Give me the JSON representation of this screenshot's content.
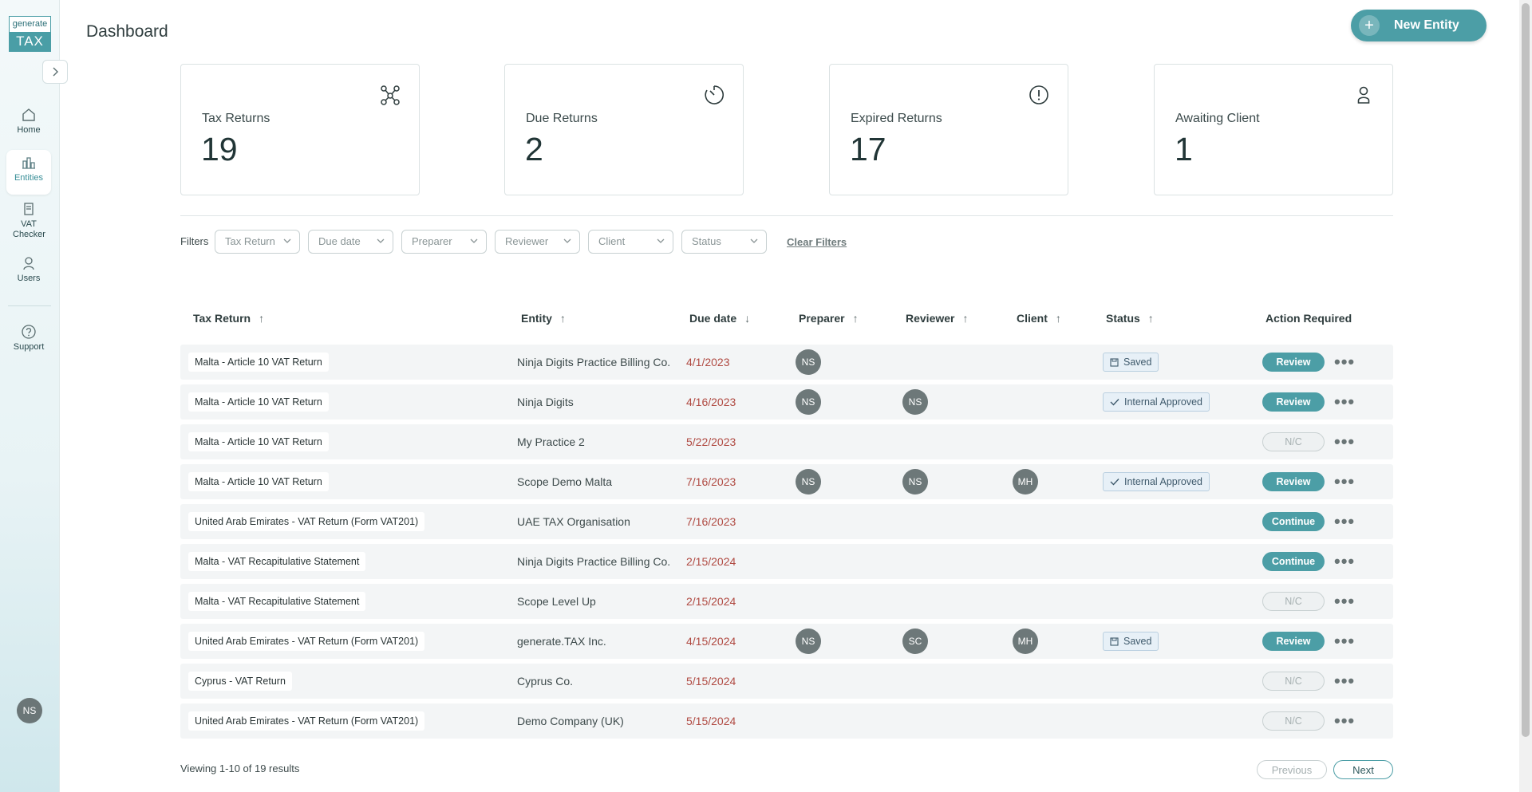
{
  "sidebar": {
    "logo_top": "generate",
    "logo_bottom": "TAX",
    "items": [
      {
        "label": "Home",
        "icon": "home-icon"
      },
      {
        "label": "Entities",
        "icon": "building-icon"
      },
      {
        "label": "VAT Checker",
        "icon": "document-icon"
      },
      {
        "label": "Users",
        "icon": "user-icon"
      },
      {
        "label": "Support",
        "icon": "help-icon"
      }
    ],
    "user_initials": "NS"
  },
  "header": {
    "title": "Dashboard",
    "new_entity_label": "New Entity"
  },
  "cards": [
    {
      "label": "Tax Returns",
      "value": "19",
      "icon": "network-icon"
    },
    {
      "label": "Due Returns",
      "value": "2",
      "icon": "timer-icon"
    },
    {
      "label": "Expired Returns",
      "value": "17",
      "icon": "alert-circle-icon"
    },
    {
      "label": "Awaiting Client",
      "value": "1",
      "icon": "person-icon"
    }
  ],
  "filters": {
    "label": "Filters",
    "items": [
      "Tax Return",
      "Due date",
      "Preparer",
      "Reviewer",
      "Client",
      "Status"
    ],
    "clear_label": "Clear Filters"
  },
  "table": {
    "columns": [
      "Tax Return",
      "Entity",
      "Due date",
      "Preparer",
      "Reviewer",
      "Client",
      "Status",
      "Action Required"
    ],
    "rows": [
      {
        "tax_return": "Malta - Article 10 VAT Return",
        "entity": "Ninja Digits Practice Billing Co.",
        "due": "4/1/2023",
        "preparer": "NS",
        "reviewer": "",
        "client": "",
        "status": "Saved",
        "action": "Review"
      },
      {
        "tax_return": "Malta - Article 10 VAT Return",
        "entity": "Ninja Digits",
        "due": "4/16/2023",
        "preparer": "NS",
        "reviewer": "NS",
        "client": "",
        "status": "Internal Approved",
        "action": "Review"
      },
      {
        "tax_return": "Malta - Article 10 VAT Return",
        "entity": "My Practice 2",
        "due": "5/22/2023",
        "preparer": "",
        "reviewer": "",
        "client": "",
        "status": "",
        "action": "N/C"
      },
      {
        "tax_return": "Malta - Article 10 VAT Return",
        "entity": "Scope Demo Malta",
        "due": "7/16/2023",
        "preparer": "NS",
        "reviewer": "NS",
        "client": "MH",
        "status": "Internal Approved",
        "action": "Review"
      },
      {
        "tax_return": "United Arab Emirates - VAT Return (Form VAT201)",
        "entity": "UAE TAX Organisation",
        "due": "7/16/2023",
        "preparer": "",
        "reviewer": "",
        "client": "",
        "status": "",
        "action": "Continue"
      },
      {
        "tax_return": "Malta - VAT Recapitulative Statement",
        "entity": "Ninja Digits Practice Billing Co.",
        "due": "2/15/2024",
        "preparer": "",
        "reviewer": "",
        "client": "",
        "status": "",
        "action": "Continue"
      },
      {
        "tax_return": "Malta - VAT Recapitulative Statement",
        "entity": "Scope Level Up",
        "due": "2/15/2024",
        "preparer": "",
        "reviewer": "",
        "client": "",
        "status": "",
        "action": "N/C"
      },
      {
        "tax_return": "United Arab Emirates - VAT Return (Form VAT201)",
        "entity": "generate.TAX Inc.",
        "due": "4/15/2024",
        "preparer": "NS",
        "reviewer": "SC",
        "client": "MH",
        "status": "Saved",
        "action": "Review"
      },
      {
        "tax_return": "Cyprus - VAT Return",
        "entity": "Cyprus Co.",
        "due": "5/15/2024",
        "preparer": "",
        "reviewer": "",
        "client": "",
        "status": "",
        "action": "N/C"
      },
      {
        "tax_return": "United Arab Emirates - VAT Return (Form VAT201)",
        "entity": "Demo Company (UK)",
        "due": "5/15/2024",
        "preparer": "",
        "reviewer": "",
        "client": "",
        "status": "",
        "action": "N/C"
      }
    ]
  },
  "footer": {
    "viewing": "Viewing 1-10 of 19 results",
    "previous_label": "Previous",
    "next_label": "Next"
  },
  "colors": {
    "accent": "#4c9ea6",
    "due_date": "#b04a42",
    "status_bg": "#e7f0f7"
  }
}
